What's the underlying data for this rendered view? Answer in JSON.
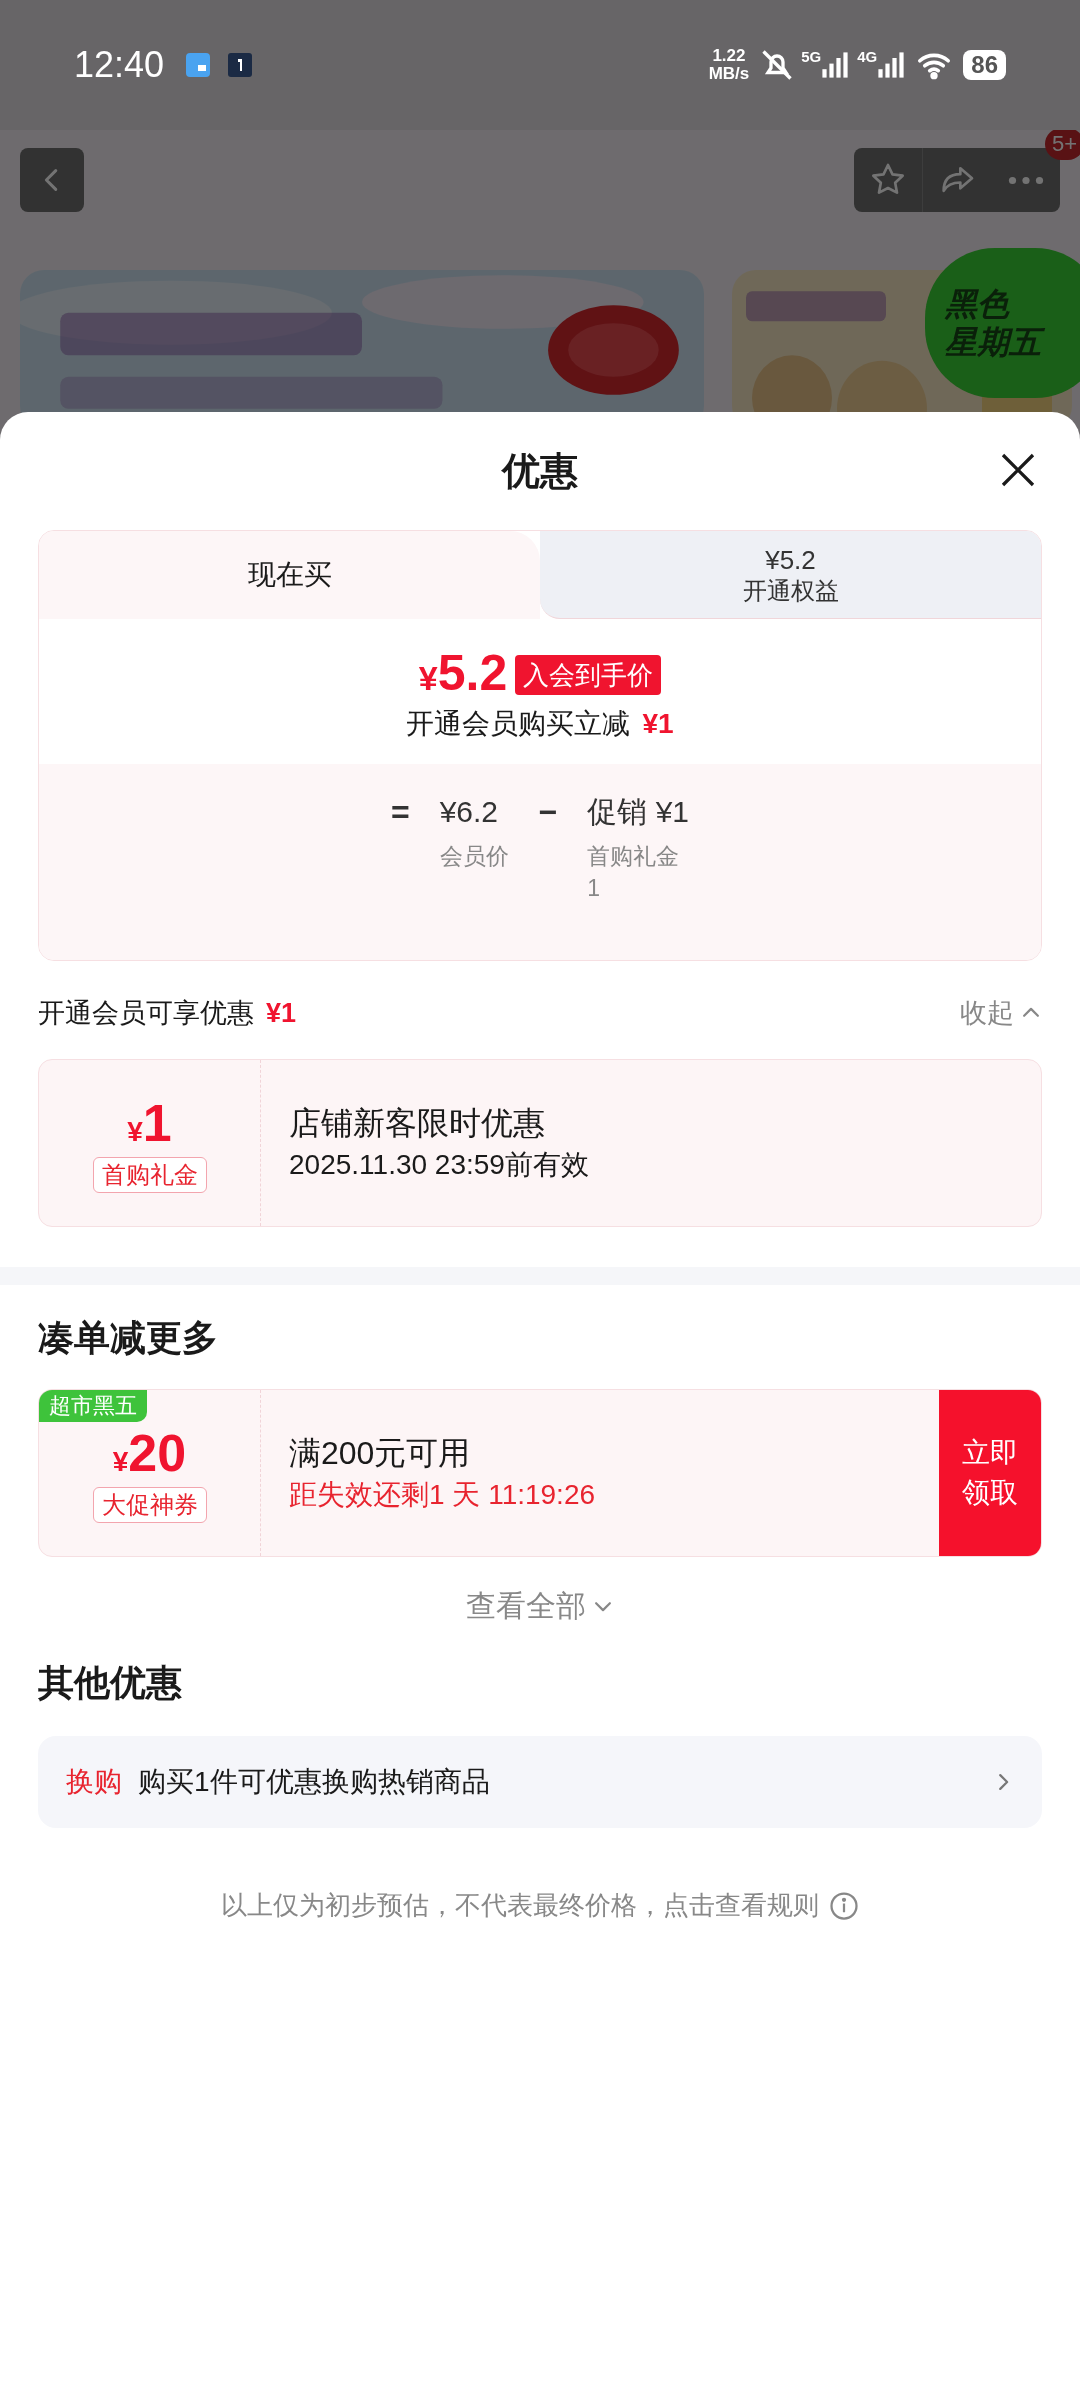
{
  "status_bar": {
    "time": "12:40",
    "net_speed": [
      "1.22",
      "MB/s"
    ],
    "network_1": "5G",
    "network_2": "4G",
    "battery": "86"
  },
  "nav": {
    "badge": "5+"
  },
  "promo_badge": [
    "黑色",
    "星期五"
  ],
  "sheet": {
    "title": "优惠"
  },
  "tabs": [
    {
      "label": "现在买",
      "selected": true
    },
    {
      "price": "¥5.2",
      "label": "开通权益",
      "selected": false
    }
  ],
  "summary": {
    "currency": "¥",
    "price": "5.2",
    "tag": "入会到手价",
    "note": "开通会员购买立减",
    "note_amount": "¥1",
    "formula": [
      {
        "kind": "operator",
        "text": "="
      },
      {
        "kind": "term",
        "value": "¥6.2",
        "caption": [
          "会员价"
        ]
      },
      {
        "kind": "operator",
        "text": "−"
      },
      {
        "kind": "term",
        "value": "促销 ¥1",
        "caption": [
          "首购礼金",
          "1"
        ]
      }
    ]
  },
  "member_section": {
    "label": "开通会员可享优惠",
    "amount": "¥1",
    "toggle": "收起",
    "expanded": true,
    "coupons": [
      {
        "currency": "¥",
        "amount": "1",
        "tag": "首购礼金",
        "title": "店铺新客限时优惠",
        "subtitle": "2025.11.30 23:59前有效"
      }
    ]
  },
  "more_section": {
    "title": "凑单减更多",
    "coupons": [
      {
        "ribbon": "超市黑五",
        "currency": "¥",
        "amount": "20",
        "tag": "大促神券",
        "title": "满200元可用",
        "subtitle": "距失效还剩1 天 11:19:26",
        "action": "立即领取"
      }
    ],
    "view_all": "查看全部"
  },
  "other_section": {
    "title": "其他优惠",
    "items": [
      {
        "tag": "换购",
        "text": "购买1件可优惠换购热销商品"
      }
    ]
  },
  "footer": "以上仅为初步预估，不代表最终价格，点击查看规则"
}
